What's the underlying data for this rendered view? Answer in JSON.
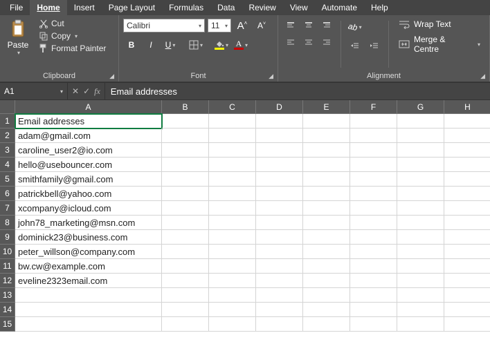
{
  "menu": [
    "File",
    "Home",
    "Insert",
    "Page Layout",
    "Formulas",
    "Data",
    "Review",
    "View",
    "Automate",
    "Help"
  ],
  "menu_active_index": 1,
  "ribbon": {
    "clipboard": {
      "paste": "Paste",
      "cut": "Cut",
      "copy": "Copy",
      "format_painter": "Format Painter",
      "label": "Clipboard"
    },
    "font": {
      "name": "Calibri",
      "size": "11",
      "bold": "B",
      "italic": "I",
      "underline": "U",
      "label": "Font"
    },
    "alignment": {
      "wrap": "Wrap Text",
      "merge": "Merge & Centre",
      "label": "Alignment"
    }
  },
  "formula_bar": {
    "name_box": "A1",
    "value": "Email addresses"
  },
  "columns": [
    "A",
    "B",
    "C",
    "D",
    "E",
    "F",
    "G",
    "H"
  ],
  "rows": 15,
  "selected": {
    "row": 1,
    "col": "A"
  },
  "data": {
    "A": [
      "Email addresses",
      "adam@gmail.com",
      "caroline_user2@io.com",
      "hello@usebouncer.com",
      "smithfamily@gmail.com",
      "patrickbell@yahoo.com",
      "xcompany@icloud.com",
      "john78_marketing@msn.com",
      "dominick23@business.com",
      "peter_willson@company.com",
      "bw.cw@example.com",
      "eveline2323email.com",
      "",
      "",
      ""
    ]
  }
}
